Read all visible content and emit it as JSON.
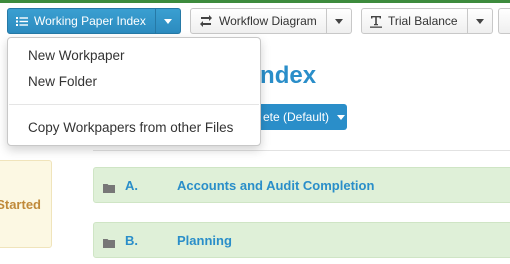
{
  "toolbar": {
    "working_paper_index": "Working Paper Index",
    "workflow_diagram": "Workflow Diagram",
    "trial_balance": "Trial Balance"
  },
  "dropdown": {
    "items": [
      "New Workpaper",
      "New Folder",
      "Copy Workpapers from other Files"
    ]
  },
  "page": {
    "title_partial": "Paper Index",
    "default_button_partial": "ete (Default)"
  },
  "side_card": {
    "label_partial": "Started"
  },
  "sections": [
    {
      "code": "A.",
      "title": "Accounts and Audit Completion"
    },
    {
      "code": "B.",
      "title": "Planning"
    }
  ],
  "colors": {
    "accent_blue": "#2a8ec9",
    "section_green": "#dff0d8",
    "card_yellow": "#fcf8e3",
    "top_bar_green": "#3d8b3d"
  },
  "icons": {
    "working_paper_index": "list-icon",
    "workflow_diagram": "workflow-icon",
    "trial_balance": "text-underline-icon",
    "section": "folder-icon"
  }
}
